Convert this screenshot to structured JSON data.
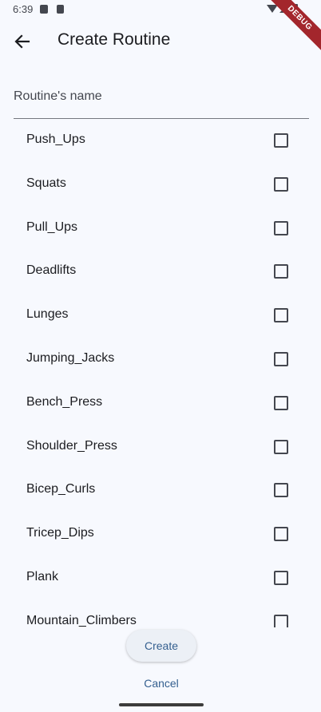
{
  "status_bar": {
    "time": "6:39"
  },
  "debug_banner": "DEBUG",
  "header": {
    "title": "Create Routine"
  },
  "form": {
    "name_placeholder": "Routine's name",
    "name_value": ""
  },
  "exercises": [
    {
      "label": "Push_Ups",
      "checked": false
    },
    {
      "label": "Squats",
      "checked": false
    },
    {
      "label": "Pull_Ups",
      "checked": false
    },
    {
      "label": "Deadlifts",
      "checked": false
    },
    {
      "label": "Lunges",
      "checked": false
    },
    {
      "label": "Jumping_Jacks",
      "checked": false
    },
    {
      "label": "Bench_Press",
      "checked": false
    },
    {
      "label": "Shoulder_Press",
      "checked": false
    },
    {
      "label": "Bicep_Curls",
      "checked": false
    },
    {
      "label": "Tricep_Dips",
      "checked": false
    },
    {
      "label": "Plank",
      "checked": false
    },
    {
      "label": "Mountain_Climbers",
      "checked": false
    }
  ],
  "actions": {
    "create_label": "Create",
    "cancel_label": "Cancel"
  }
}
